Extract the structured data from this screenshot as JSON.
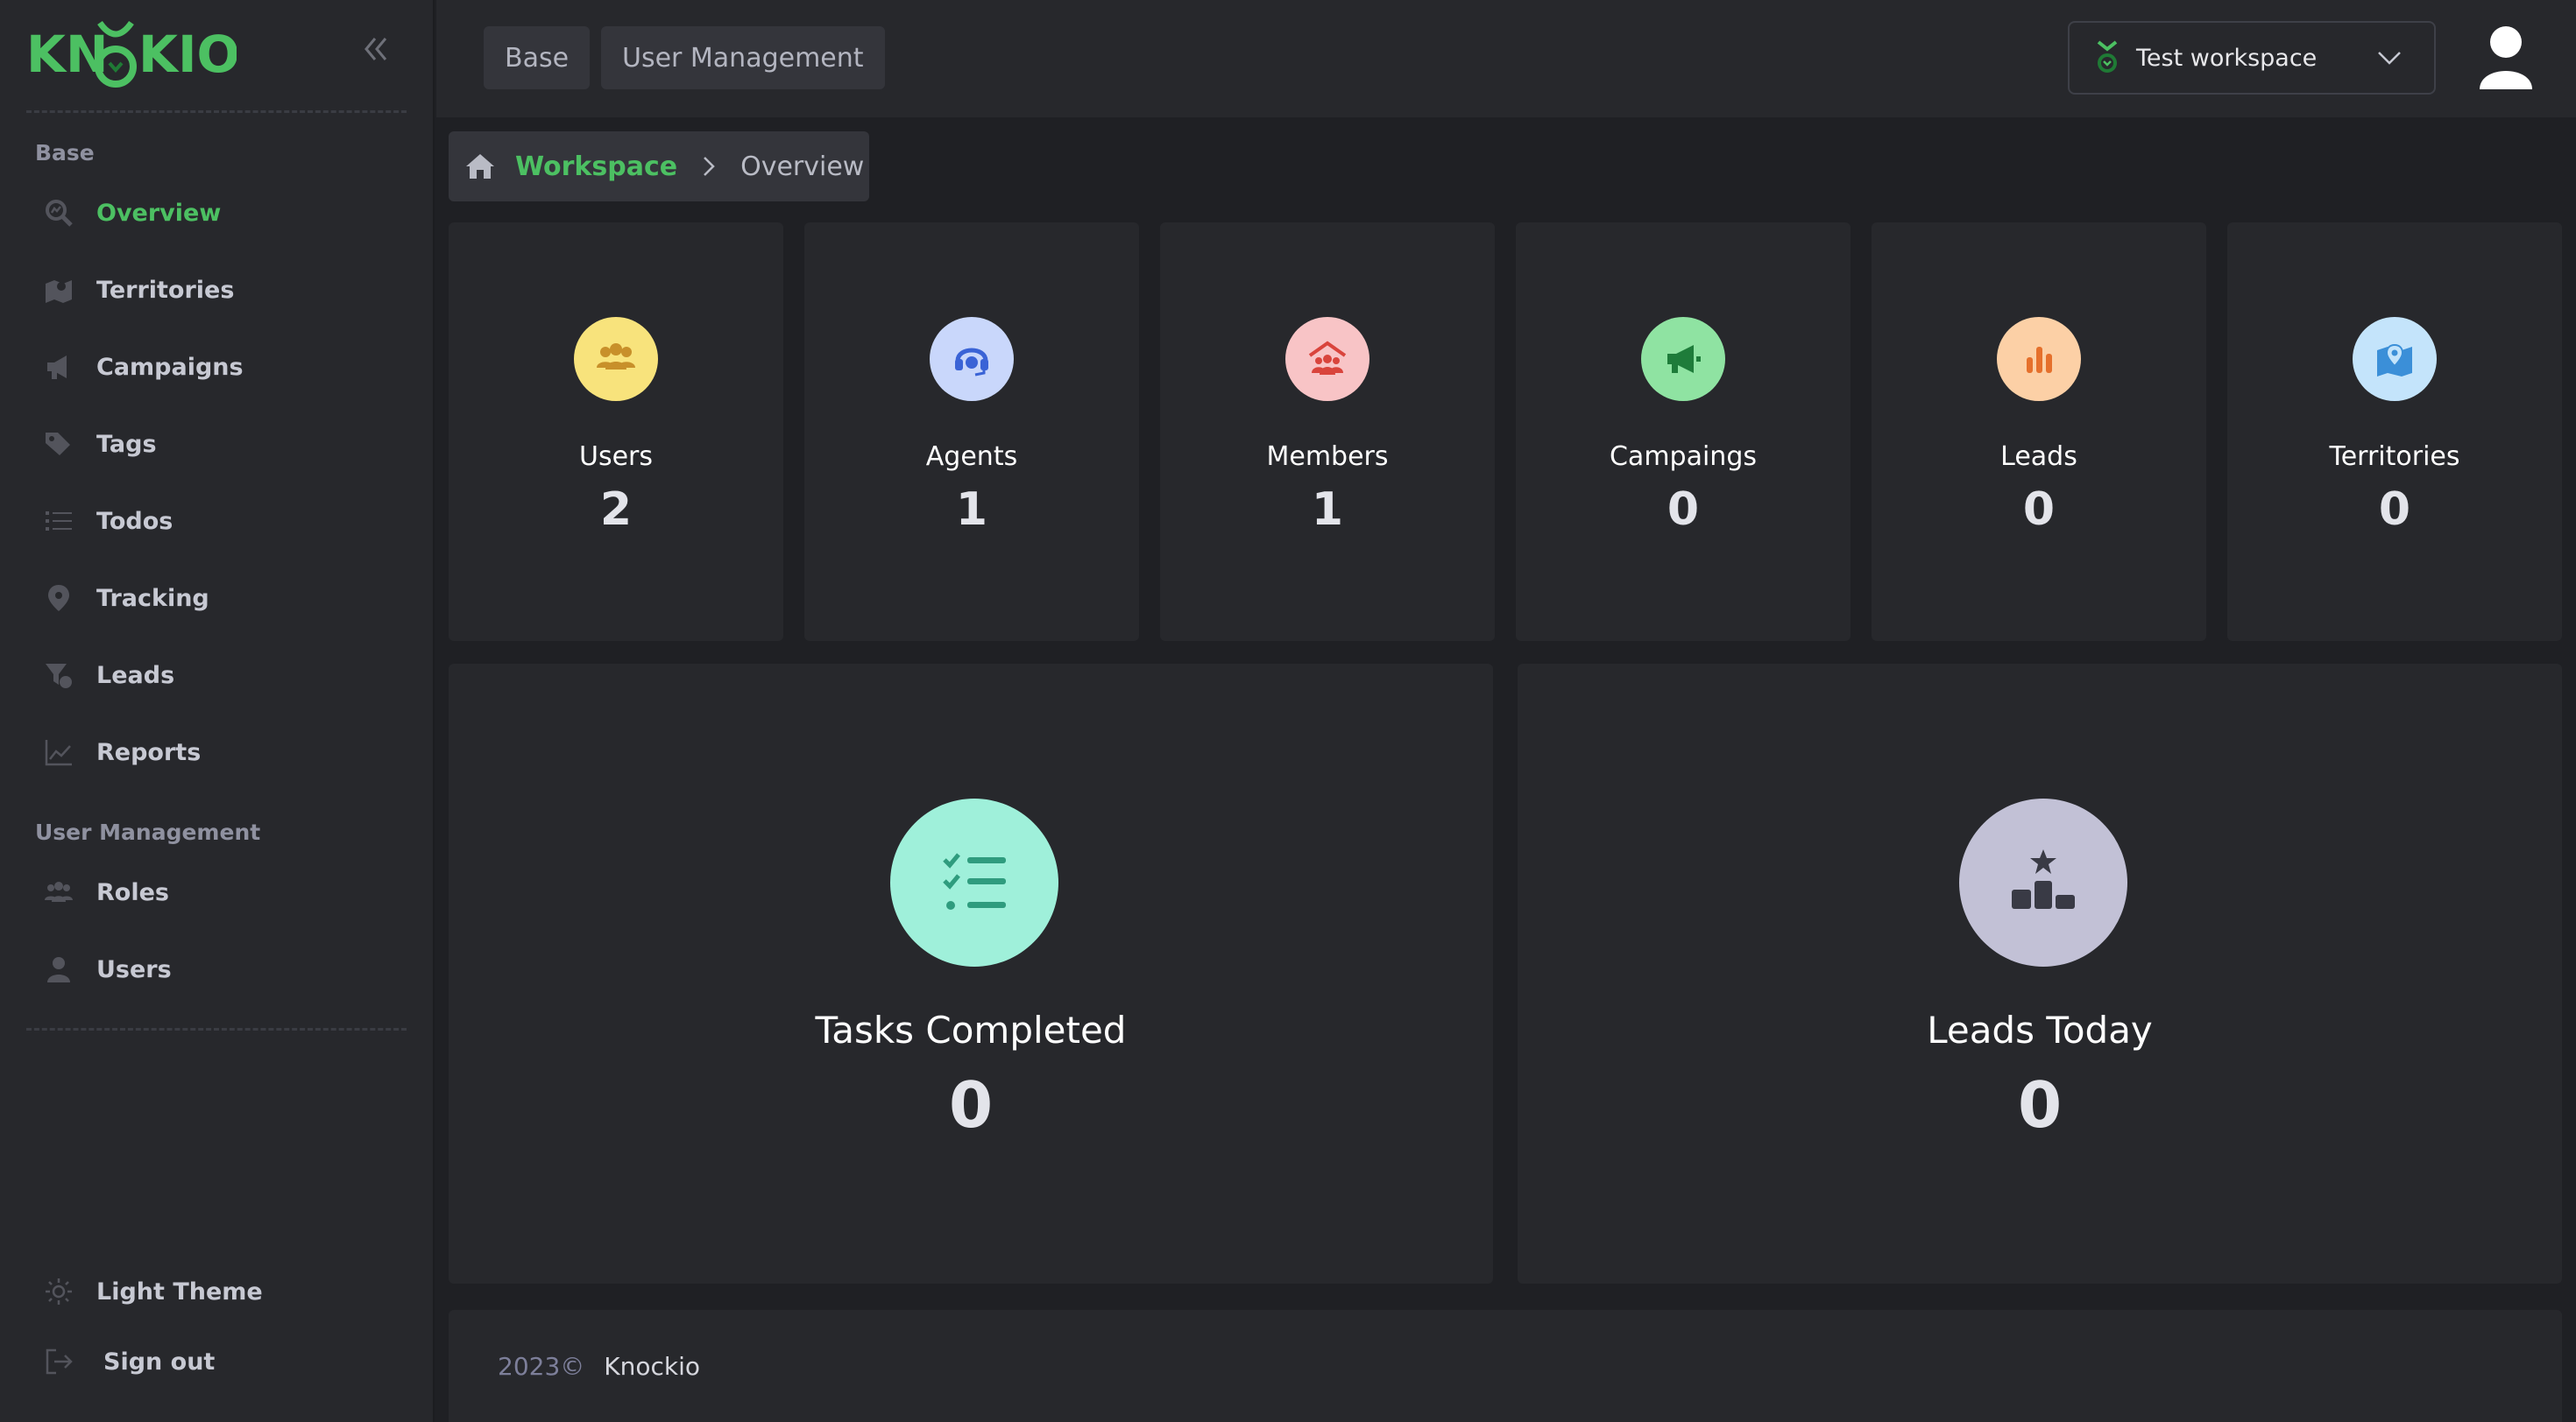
{
  "brand": {
    "logo_text": "KNOCKIO",
    "accent": "#4cc062"
  },
  "sidebar": {
    "sections": [
      {
        "label": "Base",
        "items": [
          {
            "label": "Overview",
            "icon": "overview-search-icon",
            "active": true
          },
          {
            "label": "Territories",
            "icon": "map-icon"
          },
          {
            "label": "Campaigns",
            "icon": "megaphone-icon"
          },
          {
            "label": "Tags",
            "icon": "tags-icon"
          },
          {
            "label": "Todos",
            "icon": "list-icon"
          },
          {
            "label": "Tracking",
            "icon": "location-pin-icon"
          },
          {
            "label": "Leads",
            "icon": "funnel-icon"
          },
          {
            "label": "Reports",
            "icon": "line-chart-icon"
          }
        ]
      },
      {
        "label": "User Management",
        "items": [
          {
            "label": "Roles",
            "icon": "group-icon"
          },
          {
            "label": "Users",
            "icon": "user-icon"
          }
        ]
      }
    ],
    "theme_toggle": "Light Theme",
    "sign_out": "Sign out"
  },
  "header": {
    "tabs": [
      "Base",
      "User Management"
    ],
    "workspace": {
      "name": "Test workspace"
    }
  },
  "breadcrumb": {
    "root": "Workspace",
    "current": "Overview"
  },
  "stats": [
    {
      "title": "Users",
      "value": "2",
      "icon": "users-icon",
      "bg": "#f8e37c",
      "fg": "#c8902a"
    },
    {
      "title": "Agents",
      "value": "1",
      "icon": "headset-icon",
      "bg": "#c9d7fb",
      "fg": "#3a63d6"
    },
    {
      "title": "Members",
      "value": "1",
      "icon": "members-icon",
      "bg": "#f8c4c6",
      "fg": "#d9443c"
    },
    {
      "title": "Campaings",
      "value": "0",
      "icon": "megaphone-icon",
      "bg": "#8fe3a2",
      "fg": "#1e7c3a"
    },
    {
      "title": "Leads",
      "value": "0",
      "icon": "bar-chart-icon",
      "bg": "#fcd0a6",
      "fg": "#e5702c"
    },
    {
      "title": "Territories",
      "value": "0",
      "icon": "map-pin-icon",
      "bg": "#c4e4fb",
      "fg": "#3b8fd8"
    }
  ],
  "summary": [
    {
      "title": "Tasks Completed",
      "value": "0",
      "icon": "checklist-icon",
      "bg": "#9ff0da",
      "fg": "#2f9c7e"
    },
    {
      "title": "Leads Today",
      "value": "0",
      "icon": "podium-icon",
      "bg": "#c2c1d6",
      "fg": "#393a45"
    }
  ],
  "footer": {
    "year": "2023©",
    "brand": "Knockio"
  }
}
